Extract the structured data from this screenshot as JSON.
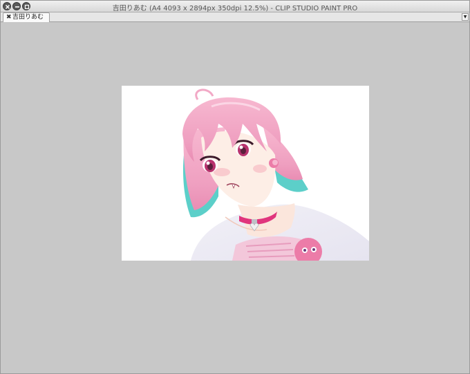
{
  "window": {
    "title": "吉田りあむ (A4 4093 x 2894px 350dpi 12.5%)  - CLIP STUDIO PAINT PRO"
  },
  "tabs": [
    {
      "label": "吉田りあむ",
      "close_glyph": "✖"
    }
  ],
  "tab_menu_glyph": "▼",
  "canvas": {
    "content": "illustration",
    "colors": {
      "background": "#ffffff",
      "workspace": "#c8c8c8",
      "hair": "#f2a9c6",
      "hair_tips": "#5ccfc9",
      "choker": "#e0357d"
    }
  }
}
